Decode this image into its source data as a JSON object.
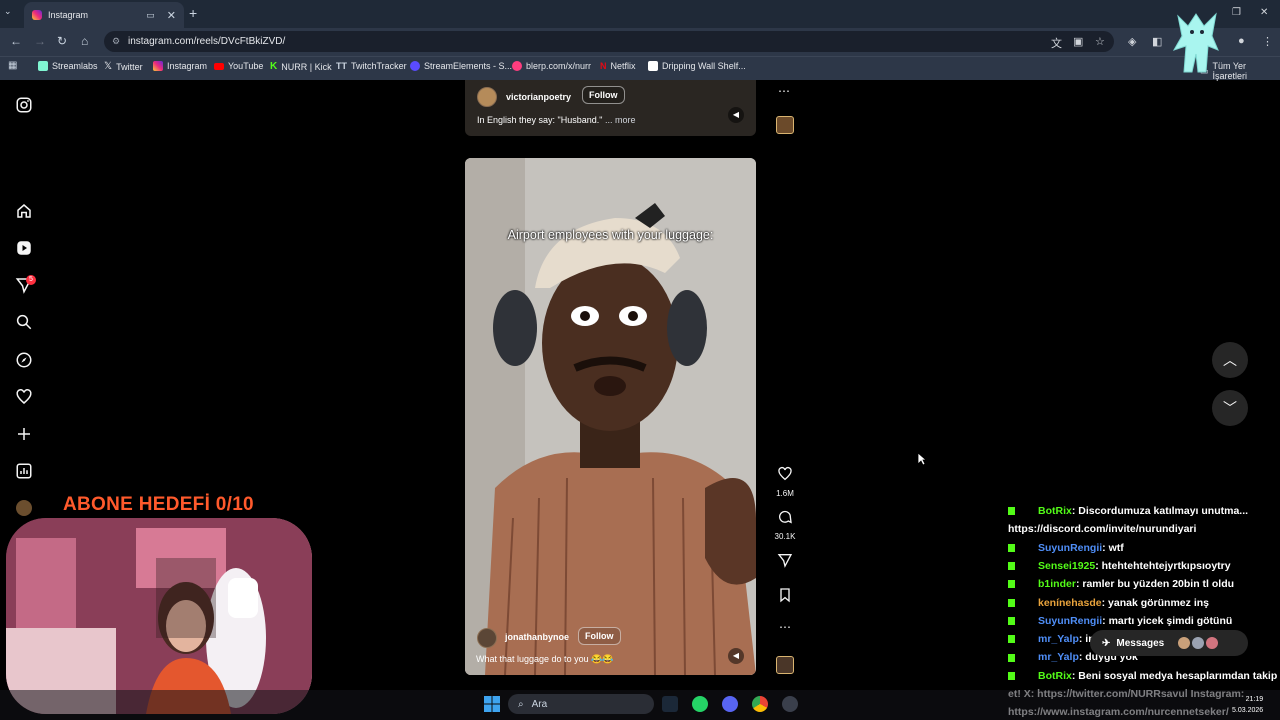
{
  "browser": {
    "tab_title": "Instagram",
    "url": "instagram.com/reels/DVcFtBkiZVD/",
    "bookmarks": [
      {
        "label": "Streamlabs",
        "color": "#80f5d2"
      },
      {
        "label": "Twitter",
        "color": "#000000"
      },
      {
        "label": "Instagram",
        "color": "#e1306c"
      },
      {
        "label": "YouTube",
        "color": "#ff0000"
      },
      {
        "label": "NURR | Kick",
        "color": "#53fc18"
      },
      {
        "label": "TwitchTracker",
        "color": "#9146ff"
      },
      {
        "label": "StreamElements - S...",
        "color": "#5a4bff"
      },
      {
        "label": "blerp.com/x/nurr",
        "color": "#ff3d7f"
      },
      {
        "label": "Netflix",
        "color": "#e50914"
      },
      {
        "label": "Dripping Wall Shelf...",
        "color": "#ffffff"
      }
    ],
    "all_bookmarks": "Tüm Yer İşaretleri"
  },
  "sidebar": {
    "notification_count": "5",
    "icons": [
      "instagram-logo-icon",
      "home-icon",
      "reels-icon",
      "messages-icon",
      "search-icon",
      "explore-icon",
      "heart-icon",
      "create-icon",
      "dashboard-icon",
      "profile-icon"
    ]
  },
  "reel_top": {
    "username": "victorianpoetry",
    "follow": "Follow",
    "caption": "In English they say: \"Husband.\"",
    "more": "... more"
  },
  "reel_main": {
    "overlay_text": "Airport employees with your luggage:",
    "username": "jonathanbynoe",
    "follow": "Follow",
    "caption": "What that luggage do to you 😂😂"
  },
  "actions": {
    "likes": "1.6M",
    "comments": "30.1K"
  },
  "overlay": {
    "goal_text": "ABONE HEDEFİ 0/10"
  },
  "chat": [
    {
      "user": "BotRix",
      "color": "#53fc18",
      "msg": ": Discordumuza katılmayı unutma..."
    },
    {
      "user": "",
      "color": "#ffffff",
      "msg": "https://discord.com/invite/nurundiyari"
    },
    {
      "user": "SuyunRengii",
      "color": "#4f8ef7",
      "msg": ": wtf"
    },
    {
      "user": "Sensei1925",
      "color": "#53fc18",
      "msg": ": htehtehtehtejyrtkıpsıoytry"
    },
    {
      "user": "b1inder",
      "color": "#53fc18",
      "msg": ": ramler bu yüzden 20bin tl oldu"
    },
    {
      "user": "kenínehasde",
      "color": "#e8a33c",
      "msg": ": yanak görünmez inş"
    },
    {
      "user": "SuyunRengii",
      "color": "#4f8ef7",
      "msg": ": martı yicek şimdi götünü"
    },
    {
      "user": "mr_Yalp",
      "color": "#4f8ef7",
      "msg": ": ingilizce şiirler çöp"
    },
    {
      "user": "mr_Yalp",
      "color": "#4f8ef7",
      "msg": ": duygu yok"
    },
    {
      "user": "BotRix",
      "color": "#53fc18",
      "msg": ": Beni sosyal medya hesaplarımdan takip"
    },
    {
      "user": "",
      "color": "#ffffff",
      "msg": "et! X: https://twitter.com/NURRsavul Instagram:"
    },
    {
      "user": "",
      "color": "#ffffff",
      "msg": "https://www.instagram.com/nurcennetseker/"
    }
  ],
  "messages_label": "Messages",
  "taskbar": {
    "search": "Ara",
    "time": "21:19",
    "date": "5.03.2026"
  }
}
